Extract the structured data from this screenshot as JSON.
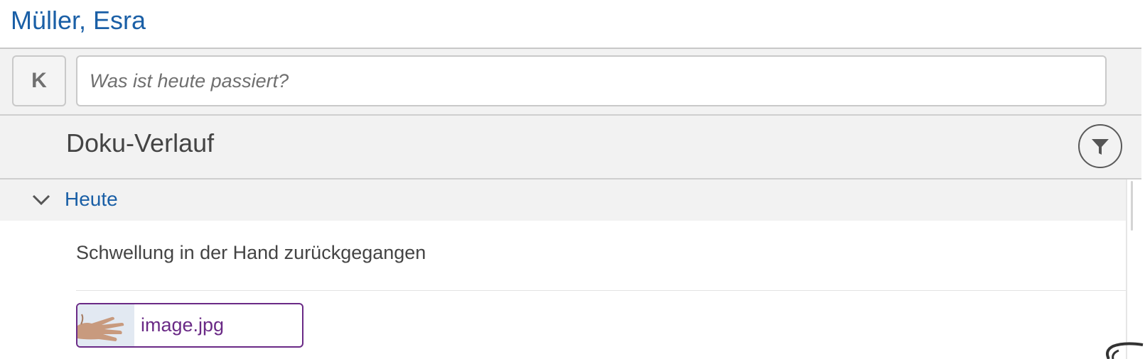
{
  "patient": {
    "name": "Müller, Esra"
  },
  "compose": {
    "avatar_letter": "K",
    "placeholder": "Was ist heute passiert?",
    "value": ""
  },
  "history": {
    "title": "Doku-Verlauf",
    "filter_icon": "filter-icon",
    "groups": [
      {
        "label": "Heute",
        "expanded": true,
        "entries": [
          {
            "text": "Schwellung in der Hand zurückgegangen",
            "attachment": {
              "filename": "image.jpg",
              "thumbnail": "hand-photo"
            }
          }
        ]
      }
    ]
  },
  "colors": {
    "link_blue": "#1a5fa6",
    "attachment_purple": "#6a2a86",
    "bar_gray": "#f2f2f2"
  }
}
